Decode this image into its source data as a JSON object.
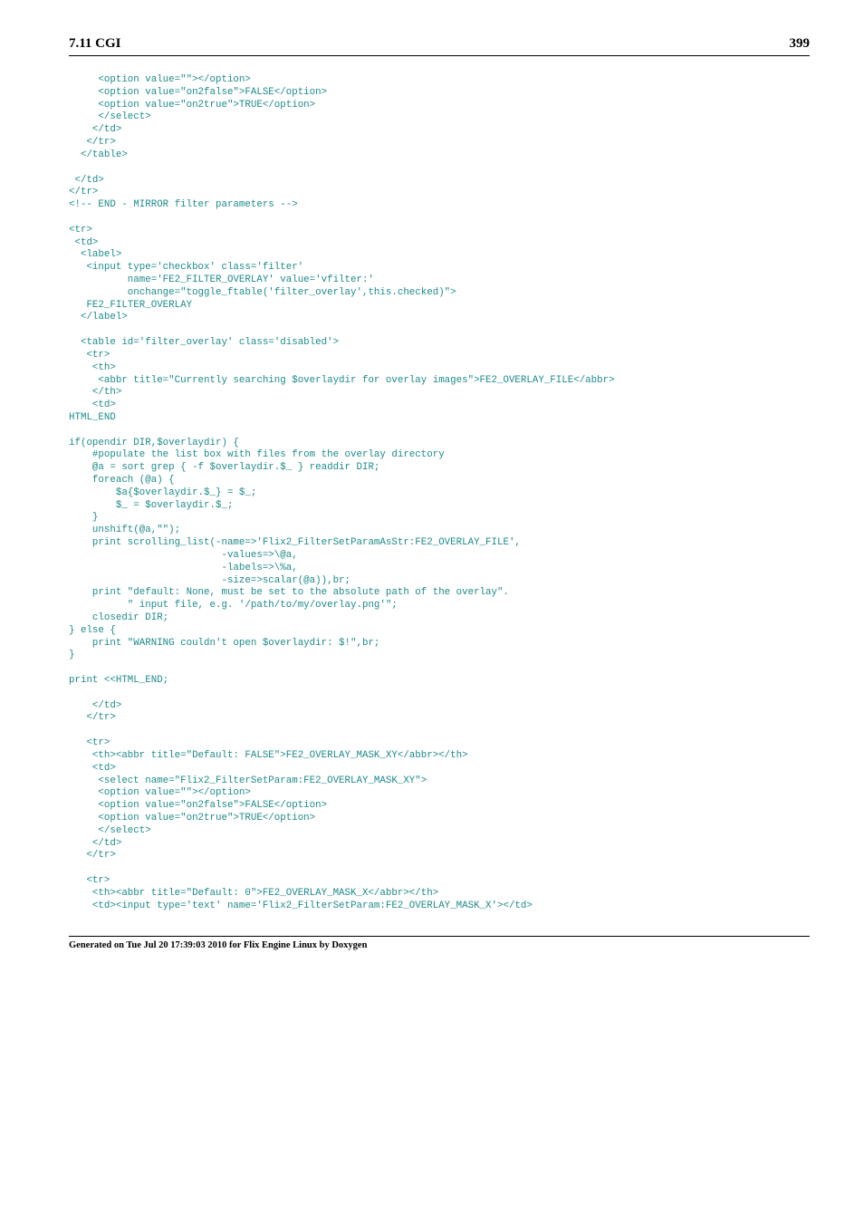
{
  "header": {
    "section": "7.11 CGI",
    "page_number": "399"
  },
  "code": {
    "lines": [
      "     <option value=\"\"></option>",
      "     <option value=\"on2false\">FALSE</option>",
      "     <option value=\"on2true\">TRUE</option>",
      "     </select>",
      "    </td>",
      "   </tr>",
      "  </table>",
      "",
      " </td>",
      "</tr>",
      "<!-- END - MIRROR filter parameters -->",
      "",
      "<tr>",
      " <td>",
      "  <label>",
      "   <input type='checkbox' class='filter'",
      "          name='FE2_FILTER_OVERLAY' value='vfilter:'",
      "          onchange=\"toggle_ftable('filter_overlay',this.checked)\">",
      "   FE2_FILTER_OVERLAY",
      "  </label>",
      "",
      "  <table id='filter_overlay' class='disabled'>",
      "   <tr>",
      "    <th>",
      "     <abbr title=\"Currently searching $overlaydir for overlay images\">FE2_OVERLAY_FILE</abbr>",
      "    </th>",
      "    <td>",
      "HTML_END",
      "",
      "if(opendir DIR,$overlaydir) {",
      "    #populate the list box with files from the overlay directory",
      "    @a = sort grep { -f $overlaydir.$_ } readdir DIR;",
      "    foreach (@a) {",
      "        $a{$overlaydir.$_} = $_;",
      "        $_ = $overlaydir.$_;",
      "    }",
      "    unshift(@a,\"\");",
      "    print scrolling_list(-name=>'Flix2_FilterSetParamAsStr:FE2_OVERLAY_FILE',",
      "                          -values=>\\@a,",
      "                          -labels=>\\%a,",
      "                          -size=>scalar(@a)),br;",
      "    print \"default: None, must be set to the absolute path of the overlay\".",
      "          \" input file, e.g. '/path/to/my/overlay.png'\";",
      "    closedir DIR;",
      "} else {",
      "    print \"WARNING couldn't open $overlaydir: $!\",br;",
      "}",
      "",
      "print <<HTML_END;",
      "",
      "    </td>",
      "   </tr>",
      "",
      "   <tr>",
      "    <th><abbr title=\"Default: FALSE\">FE2_OVERLAY_MASK_XY</abbr></th>",
      "    <td>",
      "     <select name=\"Flix2_FilterSetParam:FE2_OVERLAY_MASK_XY\">",
      "     <option value=\"\"></option>",
      "     <option value=\"on2false\">FALSE</option>",
      "     <option value=\"on2true\">TRUE</option>",
      "     </select>",
      "    </td>",
      "   </tr>",
      "",
      "   <tr>",
      "    <th><abbr title=\"Default: 0\">FE2_OVERLAY_MASK_X</abbr></th>",
      "    <td><input type='text' name='Flix2_FilterSetParam:FE2_OVERLAY_MASK_X'></td>"
    ]
  },
  "footer": {
    "generated": "Generated on Tue Jul 20 17:39:03 2010 for Flix Engine Linux by Doxygen"
  }
}
